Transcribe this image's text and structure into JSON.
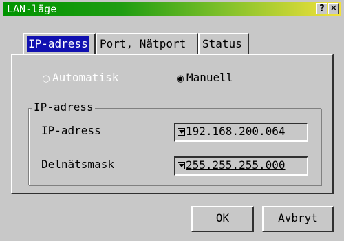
{
  "window": {
    "title": "LAN-läge",
    "help_label": "?",
    "close_label": "✕"
  },
  "tabs": [
    {
      "label": "IP-adress",
      "active": true
    },
    {
      "label": "Port, Nätport",
      "active": false
    },
    {
      "label": "Status",
      "active": false
    }
  ],
  "mode": {
    "automatic_label": "Automatisk",
    "manual_label": "Manuell",
    "selected": "Manuell"
  },
  "group": {
    "label": "IP-adress",
    "ip_label": "IP-adress",
    "ip_value": "192.168.200.064",
    "mask_label": "Delnätsmask",
    "mask_value": "255.255.255.000"
  },
  "buttons": {
    "ok_label": "OK",
    "cancel_label": "Avbryt"
  },
  "colors": {
    "title_gradient_start": "#009400",
    "title_gradient_end": "#f4e23c",
    "active_tab": "#1010b0"
  }
}
